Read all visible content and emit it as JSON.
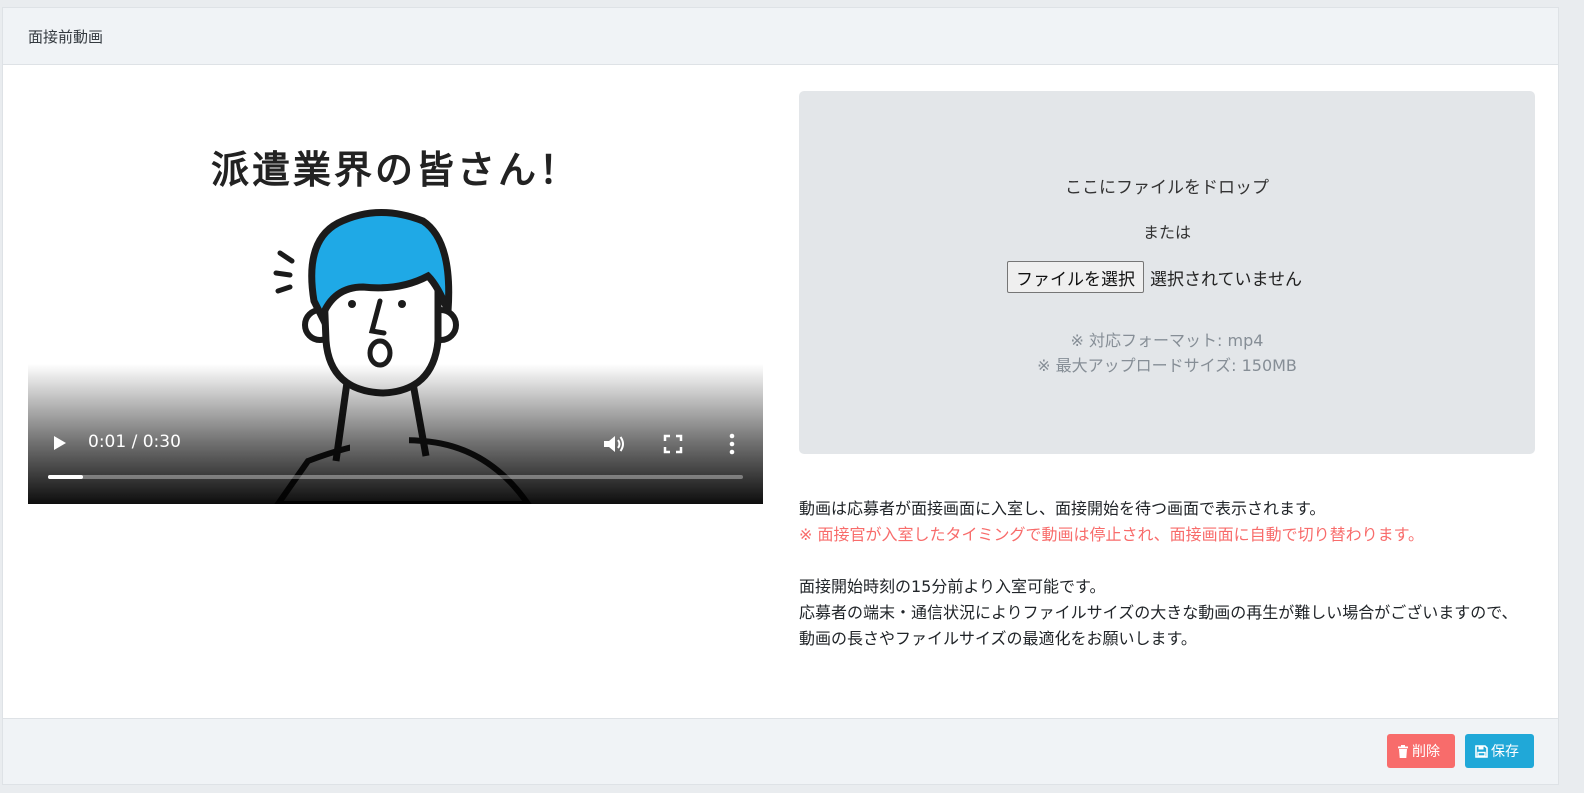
{
  "card": {
    "title": "面接前動画"
  },
  "video": {
    "title_text": "派遣業界の皆さん！",
    "time": "0:01 / 0:30",
    "progress_fraction": 0.05
  },
  "upload": {
    "drop_text": "ここにファイルをドロップ",
    "or_text": "または",
    "choose_button": "ファイルを選択",
    "no_file": "選択されていません",
    "format_note": "※ 対応フォーマット: mp4",
    "size_note": "※ 最大アップロードサイズ: 150MB"
  },
  "description": {
    "line1": "動画は応募者が面接画面に入室し、面接開始を待つ画面で表示されます。",
    "warning": "※ 面接官が入室したタイミングで動画は停止され、面接画面に自動で切り替わります。",
    "line2": "面接開始時刻の15分前より入室可能です。",
    "line3": "応募者の端末・通信状況によりファイルサイズの大きな動画の再生が難しい場合がございますので、",
    "line4": "動画の長さやファイルサイズの最適化をお願いします。"
  },
  "footer": {
    "delete_label": "削除",
    "save_label": "保存"
  },
  "colors": {
    "danger": "#f86c6b",
    "info": "#20a8d8",
    "hair": "#1fa9e6"
  }
}
